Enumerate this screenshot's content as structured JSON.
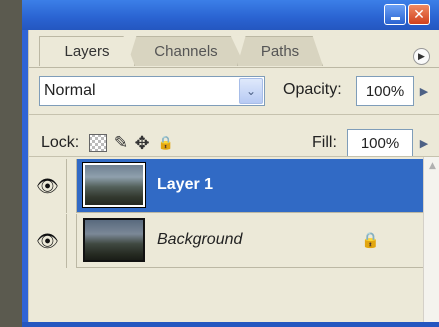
{
  "tabs": [
    {
      "label": "Layers",
      "active": true
    },
    {
      "label": "Channels",
      "active": false
    },
    {
      "label": "Paths",
      "active": false
    }
  ],
  "blend_mode": {
    "value": "Normal"
  },
  "opacity": {
    "label": "Opacity:",
    "value": "100%"
  },
  "lock": {
    "label": "Lock:"
  },
  "fill": {
    "label": "Fill:",
    "value": "100%"
  },
  "layers": [
    {
      "name": "Layer 1",
      "selected": true,
      "visible": true
    },
    {
      "name": "Background",
      "selected": false,
      "visible": true,
      "locked": true
    }
  ],
  "icons": {
    "eye": "eye-icon",
    "lock_transparent": "lock-transparent-pixels-icon",
    "lock_image": "brush-icon",
    "lock_position": "move-icon",
    "lock_all": "padlock-icon",
    "flyout": "panel-menu-icon"
  },
  "colors": {
    "selection": "#316ac5",
    "panel_bg": "#ece9d8",
    "titlebar": "#2a63d1"
  }
}
